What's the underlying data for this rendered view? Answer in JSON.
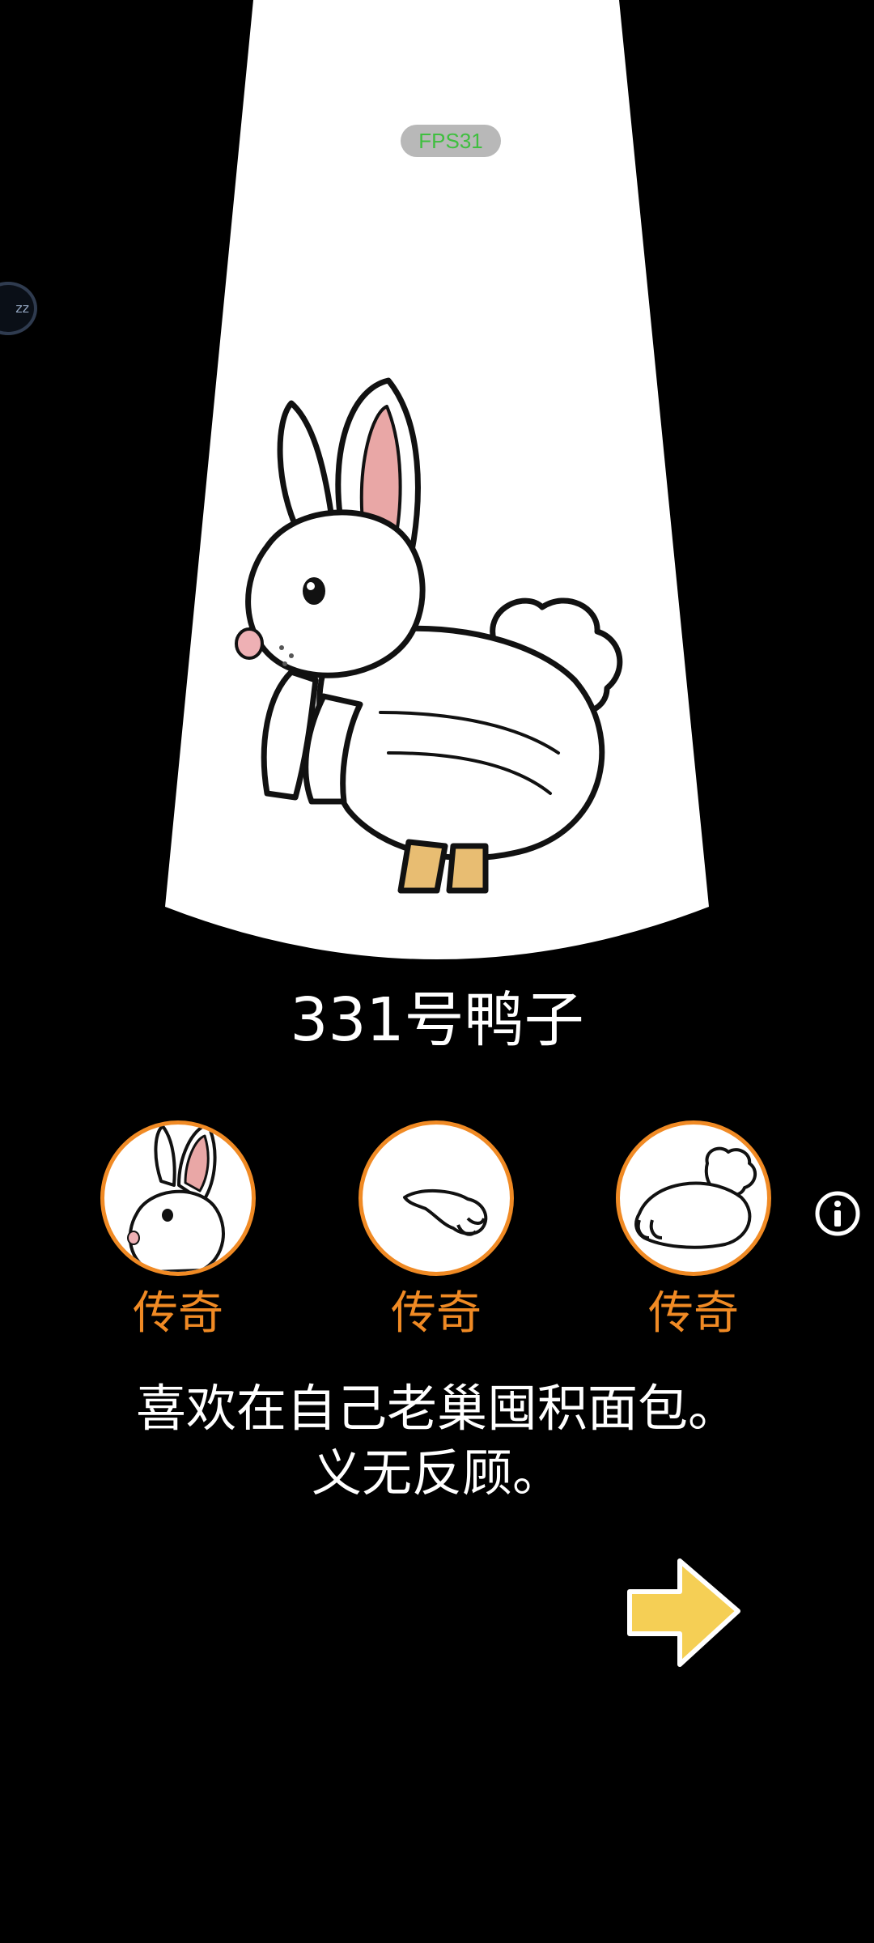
{
  "hud": {
    "fps_label": "FPS31",
    "float_ball_label": "zz"
  },
  "creature": {
    "name": "331号鸭子",
    "description_lines": [
      "喜欢在自己老巢囤积面包。",
      "义无反顾。"
    ]
  },
  "parts": [
    {
      "icon": "rabbit-head-icon",
      "rarity": "传奇"
    },
    {
      "icon": "rabbit-arm-icon",
      "rarity": "传奇"
    },
    {
      "icon": "rabbit-body-icon",
      "rarity": "传奇"
    }
  ],
  "actions": {
    "info_icon": "info-icon",
    "next_icon": "arrow-right-icon"
  },
  "colors": {
    "background": "#000000",
    "rarity_legendary": "#f08a24",
    "arrow_fill": "#f5cf55",
    "fps_text": "#3fbf3f"
  }
}
